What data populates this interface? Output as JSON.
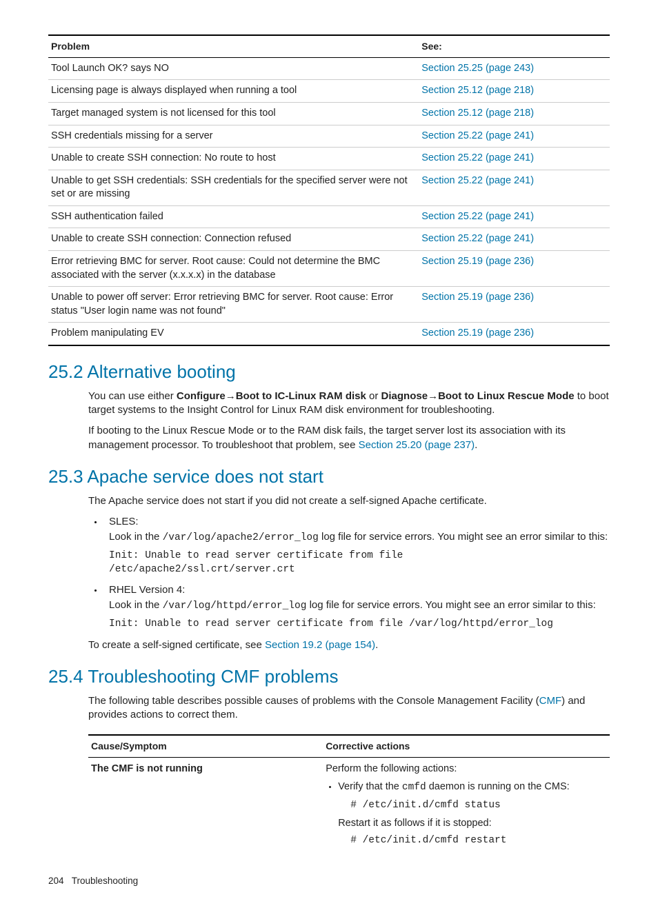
{
  "table1": {
    "headers": {
      "problem": "Problem",
      "see": "See:"
    },
    "rows": [
      {
        "problem": "Tool Launch OK? says NO",
        "see": "Section 25.25 (page 243)"
      },
      {
        "problem": "Licensing page is always displayed when running a tool",
        "see": "Section 25.12 (page 218)"
      },
      {
        "problem": "Target managed system is not licensed for this tool",
        "see": "Section 25.12 (page 218)"
      },
      {
        "problem": "SSH credentials missing for a server",
        "see": "Section 25.22 (page 241)"
      },
      {
        "problem": "Unable to create SSH connection: No route to host",
        "see": "Section 25.22 (page 241)"
      },
      {
        "problem": "Unable to get SSH credentials: SSH credentials for the specified server were not set or are missing",
        "see": "Section 25.22 (page 241)"
      },
      {
        "problem": "SSH authentication failed",
        "see": "Section 25.22 (page 241)"
      },
      {
        "problem": "Unable to create SSH connection: Connection refused",
        "see": "Section 25.22 (page 241)"
      },
      {
        "problem": "Error retrieving BMC for server. Root cause: Could not determine the BMC associated with the server (x.x.x.x) in the database",
        "see": "Section 25.19 (page 236)"
      },
      {
        "problem": "Unable to power off server: Error retrieving BMC for server. Root cause: Error status \"User login name was not found\"",
        "see": "Section 25.19 (page 236)"
      },
      {
        "problem": "Problem manipulating EV",
        "see": "Section 25.19 (page 236)"
      }
    ]
  },
  "sec252": {
    "title": "25.2 Alternative booting",
    "p1a": "You can use either ",
    "configure": "Configure",
    "arrow": "→",
    "boot_ram": "Boot to IC-Linux RAM disk",
    "or": " or ",
    "diagnose": "Diagnose",
    "boot_rescue": "Boot to Linux Rescue Mode",
    "p1b": " to boot target systems to the Insight Control for Linux RAM disk environment for troubleshooting.",
    "p2a": "If booting to the Linux Rescue Mode or to the RAM disk fails, the target server lost its association with its management processor. To troubleshoot that problem, see ",
    "p2link": "Section 25.20 (page 237)",
    "p2b": "."
  },
  "sec253": {
    "title": "25.3 Apache service does not start",
    "intro": "The Apache service does not start if you did not create a self-signed Apache certificate.",
    "sles_label": "SLES:",
    "sles_text_a": "Look in the ",
    "sles_path": "/var/log/apache2/error_log",
    "sles_text_b": " log file for service errors. You might see an error similar to this:",
    "sles_code": "Init: Unable to read server certificate from file\n/etc/apache2/ssl.crt/server.crt",
    "rhel_label": "RHEL Version 4:",
    "rhel_text_a": "Look in the ",
    "rhel_path": "/var/log/httpd/error_log",
    "rhel_text_b": " log file for service errors. You might see an error similar to this:",
    "rhel_code": "Init: Unable to read server certificate from file /var/log/httpd/error_log",
    "outro_a": "To create a self-signed certificate, see ",
    "outro_link": "Section 19.2 (page 154)",
    "outro_b": "."
  },
  "sec254": {
    "title": "25.4 Troubleshooting CMF problems",
    "intro_a": "The following table describes possible causes of problems with the Console Management Facility (",
    "cmf": "CMF",
    "intro_b": ") and provides actions to correct them.",
    "headers": {
      "cause": "Cause/Symptom",
      "action": "Corrective actions"
    },
    "row": {
      "cause": "The CMF is not running",
      "perform": "Perform the following actions:",
      "verify_a": "Verify that the ",
      "cmfd": "cmfd",
      "verify_b": " daemon is running on the CMS:",
      "cmd1": "# /etc/init.d/cmfd status",
      "restart": "Restart it as follows if it is stopped:",
      "cmd2": "# /etc/init.d/cmfd restart"
    }
  },
  "footer": {
    "page": "204",
    "title": "Troubleshooting"
  }
}
